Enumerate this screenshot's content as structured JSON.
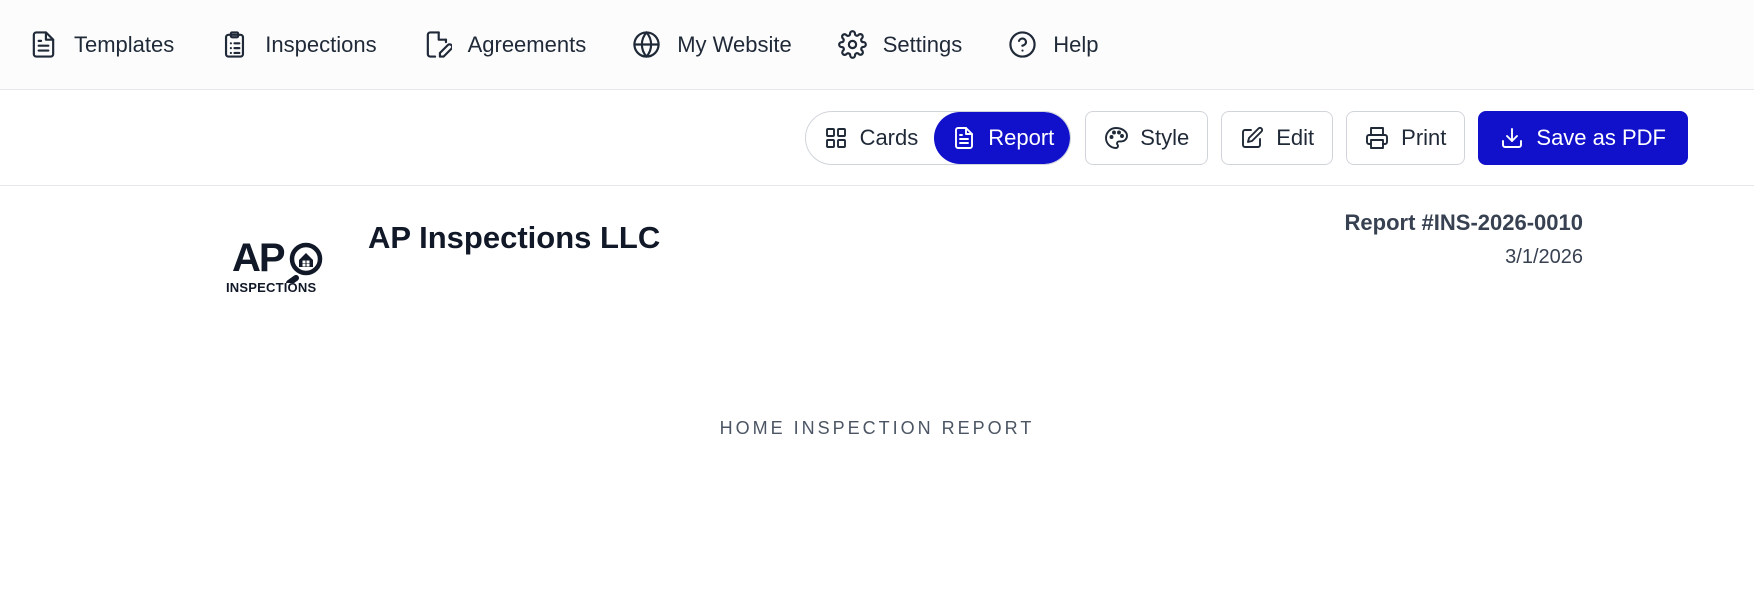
{
  "nav": {
    "items": [
      {
        "label": "Templates",
        "icon": "document-icon"
      },
      {
        "label": "Inspections",
        "icon": "clipboard-icon"
      },
      {
        "label": "Agreements",
        "icon": "signature-icon"
      },
      {
        "label": "My Website",
        "icon": "globe-icon"
      },
      {
        "label": "Settings",
        "icon": "gear-icon"
      },
      {
        "label": "Help",
        "icon": "help-circle-icon"
      }
    ]
  },
  "toolbar": {
    "view_cards": "Cards",
    "view_report": "Report",
    "style": "Style",
    "edit": "Edit",
    "print": "Print",
    "save_pdf": "Save as PDF"
  },
  "report": {
    "logo_text": "AP",
    "logo_subtext": "INSPECTIONS",
    "company": "AP Inspections LLC",
    "number": "Report #INS-2026-0010",
    "date": "3/1/2026",
    "title": "HOME INSPECTION REPORT"
  },
  "colors": {
    "accent": "#1111cc",
    "text": "#1f2937",
    "muted": "#4b5563",
    "border": "#d1d5db"
  }
}
